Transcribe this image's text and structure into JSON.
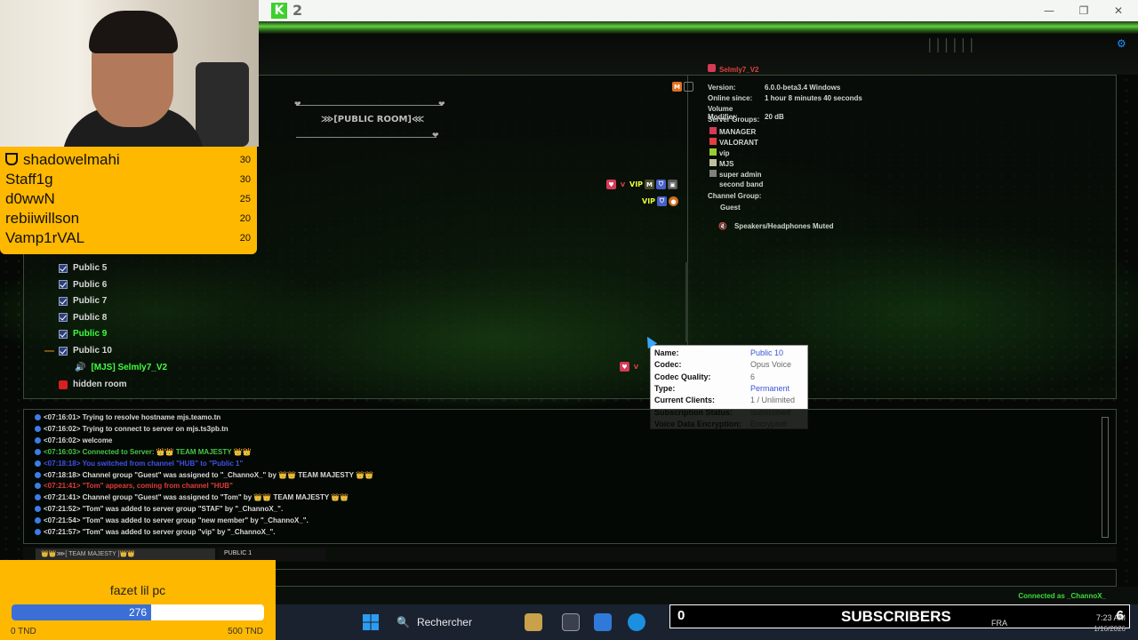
{
  "window": {
    "version_badge": "2",
    "minimize": "—",
    "maximize": "❐",
    "close": "✕"
  },
  "room_banner": {
    "label": "⋙[PUBLIC ROOM]⋘"
  },
  "server_info": {
    "user": "Selmly7_V2",
    "rows": [
      {
        "key": "Version:",
        "value": "6.0.0-beta3.4 Windows"
      },
      {
        "key": "Online since:",
        "value": "1 hour 8 minutes 40 seconds"
      },
      {
        "key": "Volume Modifier:",
        "value": "20 dB"
      }
    ],
    "server_groups_label": "Server Groups:",
    "groups": [
      "MANAGER",
      "VALORANT",
      "vip",
      "MJS",
      "super admin",
      "second band"
    ],
    "channel_group_label": "Channel Group:",
    "channel_group": "Guest",
    "status": "Speakers/Headphones Muted"
  },
  "channel_tree": {
    "items": [
      {
        "label": "Public 5",
        "active": false
      },
      {
        "label": "Public 6",
        "active": false
      },
      {
        "label": "Public 7",
        "active": false
      },
      {
        "label": "Public 8",
        "active": false
      },
      {
        "label": "Public 9",
        "active": true
      },
      {
        "label": "Public 10",
        "active": false
      }
    ],
    "user_in_channel": "[MJS] Selmly7_V2",
    "hidden_room": "hidden room"
  },
  "tooltip": {
    "rows": [
      {
        "key": "Name:",
        "value": "Public 10",
        "link": true
      },
      {
        "key": "Codec:",
        "value": "Opus Voice",
        "link": false
      },
      {
        "key": "Codec Quality:",
        "value": "6",
        "link": false
      },
      {
        "key": "Type:",
        "value": "Permanent",
        "link": true
      },
      {
        "key": "Current Clients:",
        "value": "1 / Unlimited",
        "link": false
      },
      {
        "key": "Subscription Status:",
        "value": "Subscribed",
        "link": false
      },
      {
        "key": "Voice Data Encryption:",
        "value": "Encrypted",
        "link": false
      }
    ]
  },
  "log": {
    "lines": [
      "<07:16:01> Trying to resolve hostname mjs.teamo.tn",
      "<07:16:02> Trying to connect to server on mjs.ts3pb.tn",
      "<07:16:02> welcome",
      "<07:16:03> Connected to Server: 👑👑 TEAM MAJESTY 👑👑",
      "<07:18:18> You switched from channel \"HUB\" to \"Public 1\"",
      "<07:18:18> Channel group \"Guest\" was assigned to \"_ChannoX_\" by 👑👑 TEAM MAJESTY 👑👑",
      "<07:21:41> \"Tom\" appears, coming from channel \"HUB\"",
      "<07:21:41> Channel group \"Guest\" was assigned to \"Tom\" by 👑👑 TEAM MAJESTY 👑👑",
      "<07:21:52> \"Tom\" was added to server group \"STAF\" by \"_ChannoX_\".",
      "<07:21:54> \"Tom\" was added to server group \"new member\" by \"_ChannoX_\".",
      "<07:21:57> \"Tom\" was added to server group \"vip\" by \"_ChannoX_\"."
    ]
  },
  "tabs": [
    {
      "label": "👑👑⋙[ TEAM MAJESTY ]👑👑"
    },
    {
      "label": "PUBLIC 1"
    }
  ],
  "status_bar": {
    "connected_as": "Connected as _ChannoX_"
  },
  "leaderboard": {
    "rows": [
      {
        "name": "shadowelmahi",
        "score": "30"
      },
      {
        "name": "Staff1g",
        "score": "30"
      },
      {
        "name": "d0wwN",
        "score": "25"
      },
      {
        "name": "rebiiwillson",
        "score": "20"
      },
      {
        "name": "Vamp1rVAL",
        "score": "20"
      }
    ]
  },
  "donation": {
    "title": "fazet lil pc",
    "current": "276",
    "min": "0 TND",
    "max": "500 TND",
    "progress_fraction": 0.552
  },
  "taskbar": {
    "search_placeholder": "Rechercher"
  },
  "subscribers": {
    "count_left": "0",
    "label": "SUBSCRIBERS",
    "count_right": "6"
  },
  "tray": {
    "lang": "FRA",
    "time": "7:23 AM",
    "date": "1/16/2026"
  }
}
